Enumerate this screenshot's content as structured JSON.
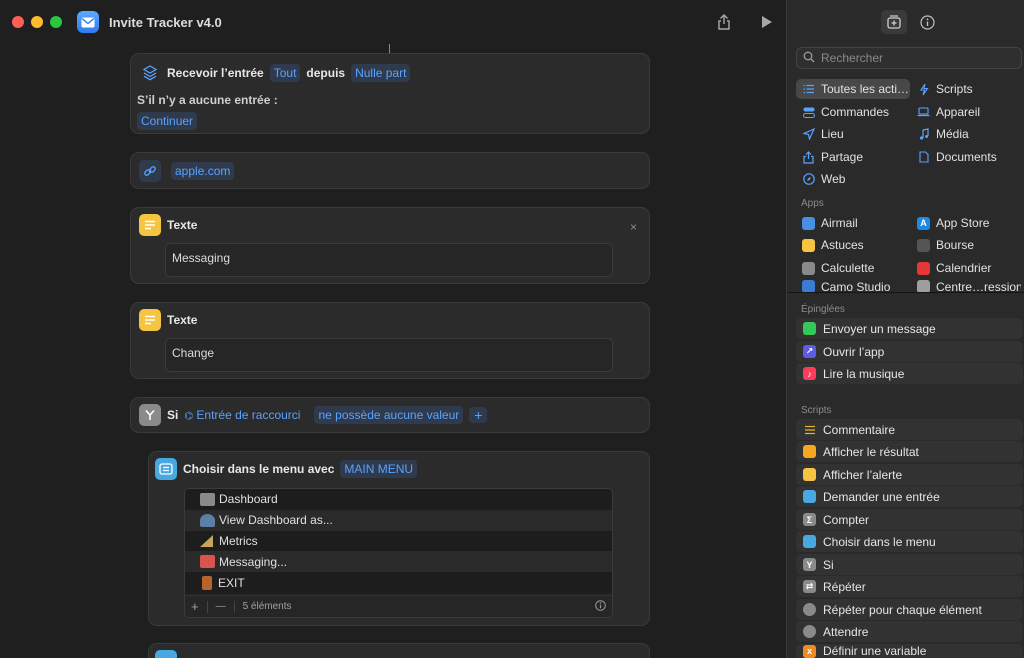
{
  "window": {
    "title": "Invite Tracker v4.0"
  },
  "editor": {
    "receive": {
      "label": "Recevoir l’entrée",
      "type_token": "Tout",
      "from_label": "depuis",
      "source_token": "Nulle part",
      "if_none_label": "S’il n’y a aucune entrée :",
      "continue_token": "Continuer"
    },
    "url": {
      "value": "apple.com"
    },
    "text1": {
      "label": "Texte",
      "value": "Messaging",
      "close": "×"
    },
    "text2": {
      "label": "Texte",
      "value": "Change"
    },
    "if": {
      "label": "Si",
      "input_token": "Entrée de raccourci",
      "condition_token": "ne possède aucune valeur",
      "add": "+"
    },
    "menu": {
      "label": "Choisir dans le menu avec",
      "prompt_token": "MAIN MENU",
      "items": [
        {
          "label": "Dashboard",
          "icon": "control-knobs-icon",
          "color": "#8a8a8a"
        },
        {
          "label": "View Dashboard as...",
          "icon": "bust-icon",
          "color": "#5b7fa6"
        },
        {
          "label": "Metrics",
          "icon": "triangular-ruler-icon",
          "color": "#c9a25e"
        },
        {
          "label": "Messaging...",
          "icon": "inbox-tray-icon",
          "color": "#d9534f"
        },
        {
          "label": "EXIT",
          "icon": "door-icon",
          "color": "#b5652a"
        }
      ],
      "footer_add": "+",
      "footer_remove": "—",
      "count": "5 éléments"
    }
  },
  "library": {
    "search_placeholder": "Rechercher",
    "categories_left": [
      {
        "label": "Toutes les acti…",
        "icon": "list-icon",
        "selected": true
      },
      {
        "label": "Commandes",
        "icon": "toggles-icon"
      },
      {
        "label": "Lieu",
        "icon": "location-arrow-icon"
      },
      {
        "label": "Partage",
        "icon": "share-icon"
      },
      {
        "label": "Web",
        "icon": "compass-icon"
      }
    ],
    "categories_right": [
      {
        "label": "Scripts",
        "icon": "scripts-icon"
      },
      {
        "label": "Appareil",
        "icon": "laptop-icon"
      },
      {
        "label": "Média",
        "icon": "music-note-icon"
      },
      {
        "label": "Documents",
        "icon": "document-icon"
      }
    ],
    "apps_title": "Apps",
    "apps_left": [
      {
        "label": "Airmail",
        "color": "#4a90e2"
      },
      {
        "label": "Astuces",
        "color": "#f5c542"
      },
      {
        "label": "Calculette",
        "color": "#8a8a8a"
      },
      {
        "label": "Camo Studio",
        "color": "#3a7bd5"
      }
    ],
    "apps_right": [
      {
        "label": "App Store",
        "color": "#1e88e5"
      },
      {
        "label": "Bourse",
        "color": "#555555"
      },
      {
        "label": "Calendrier",
        "color": "#e53935"
      },
      {
        "label": "Centre…ression",
        "color": "#9e9e9e"
      }
    ],
    "pinned_title": "Épinglées",
    "pinned": [
      {
        "label": "Envoyer un message",
        "color": "#34c759"
      },
      {
        "label": "Ouvrir l’app",
        "color": "#5e5ce6"
      },
      {
        "label": "Lire la musique",
        "color": "#ff3b5c"
      }
    ],
    "scripts_title": "Scripts",
    "scripts": [
      {
        "label": "Commentaire",
        "color": "#e6b422"
      },
      {
        "label": "Afficher le résultat",
        "color": "#f5a623"
      },
      {
        "label": "Afficher l’alerte",
        "color": "#f5c542"
      },
      {
        "label": "Demander une entrée",
        "color": "#4aa8e0"
      },
      {
        "label": "Compter",
        "color": "#8a8a8a",
        "glyph": "Σ"
      },
      {
        "label": "Choisir dans le menu",
        "color": "#4aa8e0"
      },
      {
        "label": "Si",
        "color": "#8a8a8a",
        "glyph": "Y"
      },
      {
        "label": "Répéter",
        "color": "#8a8a8a"
      },
      {
        "label": "Répéter pour chaque élément",
        "color": "#8a8a8a"
      },
      {
        "label": "Attendre",
        "color": "#8a8a8a"
      },
      {
        "label": "Définir une variable",
        "color": "#f08a24",
        "glyph": "x"
      }
    ]
  }
}
